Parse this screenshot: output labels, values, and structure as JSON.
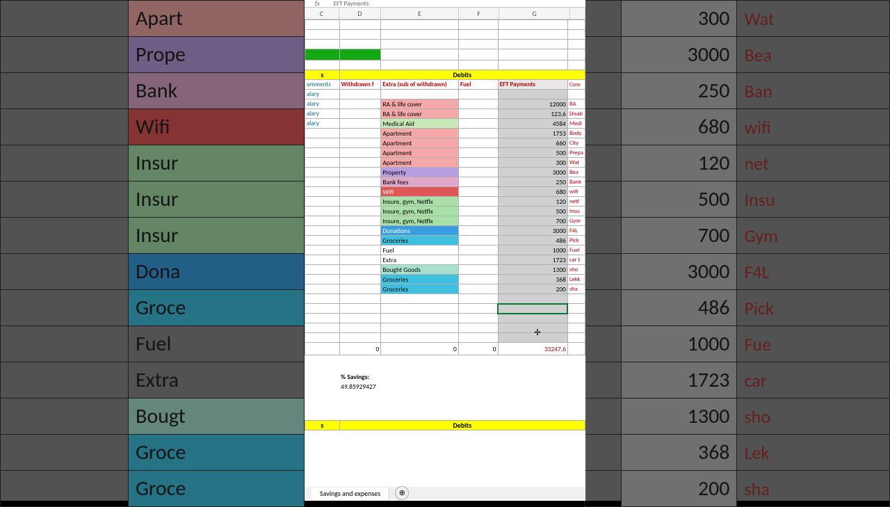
{
  "fx": {
    "label": "fx",
    "value": "EFT Payments"
  },
  "columns": [
    "C",
    "D",
    "E",
    "F",
    "G"
  ],
  "colWidths": {
    "C": 50,
    "D": 60,
    "E": 112,
    "F": 58,
    "G": 102,
    "H": 22
  },
  "topHeader": {
    "debits": "Debits"
  },
  "subHeader": {
    "comments": "omments",
    "withdrawn": "Withdrawn f",
    "extra": "Extra (sub of withdrawn)",
    "fuel": "Fuel",
    "eft": "EFT Payments",
    "com": "Com"
  },
  "salaryRows": [
    "alary",
    "alary",
    "alary",
    "alary"
  ],
  "rows": [
    {
      "cat": "RA & life cover",
      "catClass": "bg-lightred",
      "val": "12000",
      "com": "RA"
    },
    {
      "cat": "RA & life cover",
      "catClass": "bg-lightred",
      "val": "123,6",
      "com": "Disab"
    },
    {
      "cat": "Medical Aid",
      "catClass": "bg-lightgreen",
      "val": "4584",
      "com": "Medi"
    },
    {
      "cat": "Apartment",
      "catClass": "bg-lightred",
      "val": "1753",
      "com": "Body"
    },
    {
      "cat": "Apartment",
      "catClass": "bg-lightred",
      "val": "660",
      "com": "City"
    },
    {
      "cat": "Apartment",
      "catClass": "bg-lightred",
      "val": "500",
      "com": "Prepa"
    },
    {
      "cat": "Apartment",
      "catClass": "bg-lightred",
      "val": "300",
      "com": "Wat"
    },
    {
      "cat": "Property",
      "catClass": "bg-purple",
      "val": "3000",
      "com": "Bea"
    },
    {
      "cat": "Bank fees",
      "catClass": "bg-pink",
      "val": "250",
      "com": "Bank"
    },
    {
      "cat": "Wifi",
      "catClass": "bg-red",
      "val": "680",
      "com": "wifi"
    },
    {
      "cat": "Insure, gym, Netflx",
      "catClass": "bg-ltgreen2",
      "val": "120",
      "com": "netf"
    },
    {
      "cat": "Insure, gym, Netflx",
      "catClass": "bg-ltgreen2",
      "val": "500",
      "com": "Insu"
    },
    {
      "cat": "Insure, gym, Netflx",
      "catClass": "bg-ltgreen2",
      "val": "700",
      "com": "Gym"
    },
    {
      "cat": "Donations",
      "catClass": "bg-blue",
      "val": "3000",
      "com": "F4L"
    },
    {
      "cat": "Groceries",
      "catClass": "bg-cyan",
      "val": "486",
      "com": "Pick"
    },
    {
      "cat": "Fuel",
      "catClass": "",
      "val": "1000",
      "com": "Fuel"
    },
    {
      "cat": "Extra",
      "catClass": "",
      "val": "1723",
      "com": "car t"
    },
    {
      "cat": "Bought Goods",
      "catClass": "bg-mint",
      "val": "1300",
      "com": "sho"
    },
    {
      "cat": "Groceries",
      "catClass": "bg-cyan",
      "val": "368",
      "com": "Lekk"
    },
    {
      "cat": "Groceries",
      "catClass": "bg-cyan",
      "val": "200",
      "com": "sha"
    }
  ],
  "totals": {
    "D": "0",
    "E": "0",
    "F": "0",
    "G": "33247,6"
  },
  "savings": {
    "label": "% Savings:",
    "value": "49,85929427"
  },
  "bottomHeader": {
    "debits": "Debits"
  },
  "sheetTab": "Savings and expenses",
  "addIcon": "⊕",
  "bgLeft": [
    {
      "cat": "Apart",
      "cls": "bg-lightred"
    },
    {
      "cat": "Prope",
      "cls": "bg-purple"
    },
    {
      "cat": "Bank",
      "cls": "bg-pink"
    },
    {
      "cat": "Wifi",
      "cls": "bg-red"
    },
    {
      "cat": "Insur",
      "cls": "bg-ltgreen2"
    },
    {
      "cat": "Insur",
      "cls": "bg-ltgreen2"
    },
    {
      "cat": "Insur",
      "cls": "bg-ltgreen2"
    },
    {
      "cat": "Dona",
      "cls": "bg-blue"
    },
    {
      "cat": "Groce",
      "cls": "bg-cyan"
    },
    {
      "cat": "Fuel",
      "cls": ""
    },
    {
      "cat": "Extra",
      "cls": ""
    },
    {
      "cat": "Bougt",
      "cls": "bg-mint"
    },
    {
      "cat": "Groce",
      "cls": "bg-cyan"
    },
    {
      "cat": "Groce",
      "cls": "bg-cyan"
    }
  ],
  "bgRight": [
    {
      "val": "300",
      "com": "Wat"
    },
    {
      "val": "3000",
      "com": "Bea"
    },
    {
      "val": "250",
      "com": "Ban"
    },
    {
      "val": "680",
      "com": "wifi"
    },
    {
      "val": "120",
      "com": "net"
    },
    {
      "val": "500",
      "com": "Insu"
    },
    {
      "val": "700",
      "com": "Gym"
    },
    {
      "val": "3000",
      "com": "F4L"
    },
    {
      "val": "486",
      "com": "Pick"
    },
    {
      "val": "1000",
      "com": "Fue"
    },
    {
      "val": "1723",
      "com": "car"
    },
    {
      "val": "1300",
      "com": "sho"
    },
    {
      "val": "368",
      "com": "Lek"
    },
    {
      "val": "200",
      "com": "sha"
    }
  ]
}
